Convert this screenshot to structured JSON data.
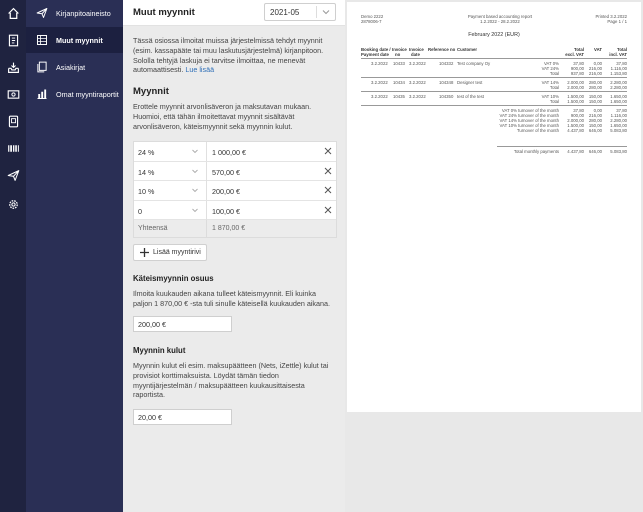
{
  "rail": {
    "icons": [
      "home-icon",
      "ledger-icon",
      "inbox-icon",
      "money-icon",
      "document-icon",
      "barcode-icon",
      "send-icon",
      "settings-icon"
    ]
  },
  "sidebar": {
    "items": [
      {
        "label": "Kirjanpitoaineisto",
        "icon": "paper-plane-icon"
      },
      {
        "label": "Muut myynnit",
        "icon": "table-icon"
      },
      {
        "label": "Asiakirjat",
        "icon": "documents-icon"
      },
      {
        "label": "Omat myyntiraportit",
        "icon": "bar-chart-icon"
      }
    ]
  },
  "panel": {
    "title": "Muut myynnit",
    "month": "2021-05",
    "intro_line1": "Tässä osiossa ilmoitat muissa järjestelmissä tehdyt myynnit",
    "intro_line2": "(esim. kassapääte tai muu laskutusjärjestelmä) kirjanpitoon.",
    "intro_line3": "Sololla tehtyjä laskuja ei tarvitse ilmoittaa, ne menevät",
    "intro_line4": "automaattisesti.",
    "read_more": "Lue lisää",
    "sales_heading": "Myynnit",
    "sales_text_line1": "Erottele myynnit arvonlisäveron ja maksutavan mukaan.",
    "sales_text_line2": "Huomioi, että tähän ilmoitettavat myynnit sisältävät",
    "sales_text_line3": "arvonlisäveron, käteismyynnit sekä myynnin kulut.",
    "sales_rows": [
      {
        "rate": "24 %",
        "amount": "1 000,00 €"
      },
      {
        "rate": "14 %",
        "amount": "570,00 €"
      },
      {
        "rate": "10 %",
        "amount": "200,00 €"
      },
      {
        "rate": "0",
        "amount": "100,00 €"
      }
    ],
    "total_label": "Yhteensä",
    "total_value": "1 870,00 €",
    "add_row": "Lisää myyntirivi",
    "cash_heading": "Käteismyynnin osuus",
    "cash_text_line1": "Ilmoita kuukauden aikana tulleet käteismyynnit. Eli kuinka",
    "cash_text_line2": "paljon 1 870,00 € -sta tuli sinulle käteisellä kuukauden aikana.",
    "cash_value": "200,00 €",
    "costs_heading": "Myynnin kulut",
    "costs_text_line1": "Myynnin kulut eli esim. maksupäätteen (Nets, iZettle) kulut tai",
    "costs_text_line2": "provisiot korttimaksuista. Löydät tämän tiedon",
    "costs_text_line3": "myyntijärjestelmän / maksupäätteen kuukausittaisesta",
    "costs_text_line4": "raportista.",
    "costs_value": "20,00 €"
  },
  "report": {
    "company": "Demo 2222",
    "company_id": "2878006-7",
    "title": "Payment based accounting report",
    "period": "1.2.2022 - 28.2.2022",
    "printed": "Printed 3.2.2022",
    "page": "Page 1 / 1",
    "subtitle": "February 2022 (EUR)",
    "headers": [
      {
        "l1": "Booking date /",
        "l2": "Payment date"
      },
      {
        "l1": "Invoice",
        "l2": "no"
      },
      {
        "l1": "Invoice",
        "l2": "date"
      },
      {
        "l1": "Reference no",
        "l2": ""
      },
      {
        "l1": "Customer",
        "l2": ""
      },
      {
        "l1": "",
        "l2": ""
      },
      {
        "l1": "Total",
        "l2": "excl. VAT"
      },
      {
        "l1": "VAT",
        "l2": ""
      },
      {
        "l1": "Total",
        "l2": "incl. VAT"
      }
    ],
    "invoices": [
      {
        "date": "3.2.2022",
        "no": "10433",
        "inv_date": "3.2.2022",
        "ref": "104332",
        "customer": "Test company Oy",
        "lines": [
          {
            "label": "VAT 0%",
            "excl": "37,80",
            "vat": "0,00",
            "incl": "37,80"
          },
          {
            "label": "VAT 24%",
            "excl": "900,00",
            "vat": "216,00",
            "incl": "1.116,00"
          },
          {
            "label": "Total",
            "excl": "937,80",
            "vat": "216,00",
            "incl": "1.153,80"
          }
        ]
      },
      {
        "date": "3.2.2022",
        "no": "10434",
        "inv_date": "3.2.2022",
        "ref": "104348",
        "customer": "Designer test",
        "lines": [
          {
            "label": "VAT 14%",
            "excl": "2.000,00",
            "vat": "280,00",
            "incl": "2.280,00"
          },
          {
            "label": "Total",
            "excl": "2.000,00",
            "vat": "280,00",
            "incl": "2.280,00"
          }
        ]
      },
      {
        "date": "3.2.2022",
        "no": "10435",
        "inv_date": "3.2.2022",
        "ref": "104350",
        "customer": "test of the test",
        "lines": [
          {
            "label": "VAT 10%",
            "excl": "1.500,00",
            "vat": "150,00",
            "incl": "1.650,00"
          },
          {
            "label": "Total",
            "excl": "1.500,00",
            "vat": "150,00",
            "incl": "1.650,00"
          }
        ]
      }
    ],
    "summary": [
      {
        "label": "VAT 0% turnover of the month",
        "excl": "37,80",
        "vat": "0,00",
        "incl": "37,80"
      },
      {
        "label": "VAT 24% turnover of the month",
        "excl": "900,00",
        "vat": "216,00",
        "incl": "1.116,00"
      },
      {
        "label": "VAT 14% turnover of the month",
        "excl": "2.000,00",
        "vat": "280,00",
        "incl": "2.280,00"
      },
      {
        "label": "VAT 10% turnover of the month",
        "excl": "1.500,00",
        "vat": "150,00",
        "incl": "1.650,00"
      },
      {
        "label": "Turnover of the month",
        "excl": "4.437,80",
        "vat": "646,00",
        "incl": "5.083,80"
      }
    ],
    "total_label": "Total monthly payments",
    "total_excl": "4.437,80",
    "total_vat": "646,00",
    "total_incl": "5.083,80"
  }
}
